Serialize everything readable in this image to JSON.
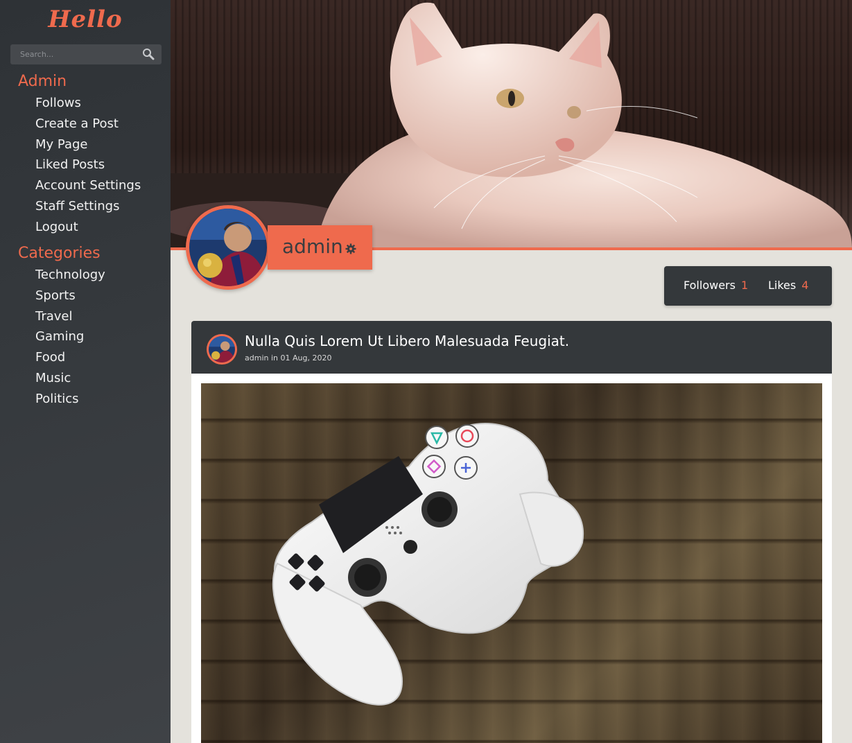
{
  "app": {
    "logo": "Hello"
  },
  "search": {
    "placeholder": "Search..."
  },
  "sidebar": {
    "admin_heading": "Admin",
    "admin_items": [
      "Follows",
      "Create a Post",
      "My Page",
      "Liked Posts",
      "Account Settings",
      "Staff Settings",
      "Logout"
    ],
    "categories_heading": "Categories",
    "category_items": [
      "Technology",
      "Sports",
      "Travel",
      "Gaming",
      "Food",
      "Music",
      "Politics"
    ]
  },
  "profile": {
    "username": "admin",
    "stats": {
      "followers_label": "Followers",
      "followers_count": "1",
      "likes_label": "Likes",
      "likes_count": "4"
    }
  },
  "post": {
    "title": "Nulla Quis Lorem Ut Libero Malesuada Feugiat.",
    "author": "admin",
    "in_word": "in",
    "date": "01 Aug, 2020"
  },
  "colors": {
    "accent": "#ef6a4d",
    "dark": "#34383b",
    "sidebar": "#35393d",
    "page_bg": "#e4e2dc"
  },
  "icons": {
    "search": "search-icon",
    "gear": "gear-icon"
  }
}
